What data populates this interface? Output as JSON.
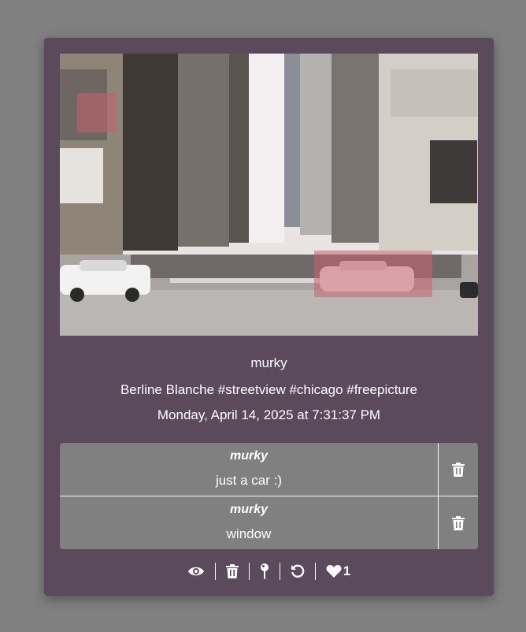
{
  "post": {
    "photo_alt": "Chicago street view",
    "username": "murky",
    "description": "Berline Blanche #streetview #chicago #freepicture",
    "date": "Monday, April 14, 2025 at 7:31:37 PM",
    "highlight_color": "#c8626e"
  },
  "comments": [
    {
      "author": "murky",
      "text": "just a car :)",
      "delete_icon": "trash-icon"
    },
    {
      "author": "murky",
      "text": "window",
      "delete_icon": "trash-icon"
    }
  ],
  "actions": {
    "view_icon": "eye-icon",
    "delete_icon": "trash-icon",
    "pin_icon": "pin-icon",
    "undo_icon": "undo-icon",
    "like_icon": "heart-icon",
    "like_count": "1"
  },
  "colors": {
    "page_bg": "#808080",
    "card_bg": "#5a4a5c",
    "comment_bg": "#808080"
  }
}
